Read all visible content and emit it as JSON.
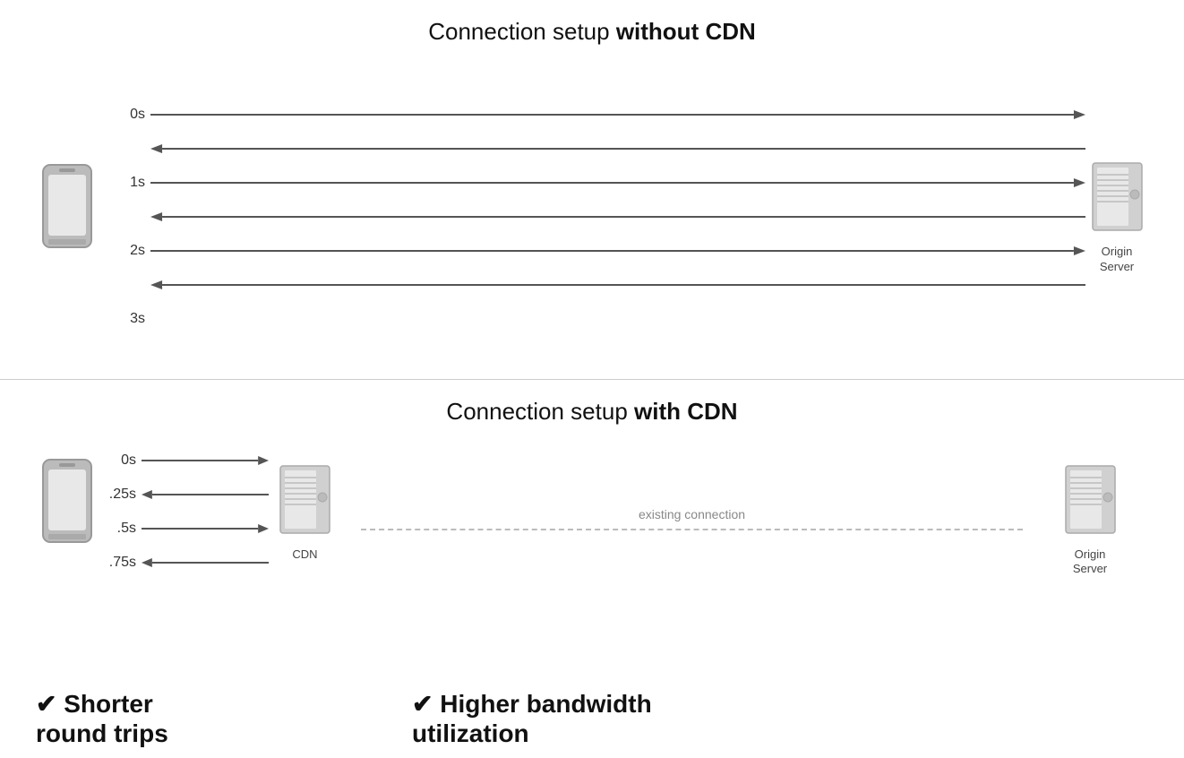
{
  "top": {
    "title_normal": "Connection setup ",
    "title_bold": "without CDN",
    "rows": [
      {
        "time": "0s",
        "direction": "right"
      },
      {
        "time": "",
        "direction": "left"
      },
      {
        "time": "1s",
        "direction": "right"
      },
      {
        "time": "",
        "direction": "left"
      },
      {
        "time": "2s",
        "direction": "right"
      },
      {
        "time": "",
        "direction": "left"
      },
      {
        "time": "3s",
        "direction": "none"
      }
    ],
    "server_label": "Origin\nServer"
  },
  "bottom": {
    "title_normal": "Connection setup ",
    "title_bold": "with CDN",
    "rows": [
      {
        "time": "0s",
        "direction": "right"
      },
      {
        "time": ".25s",
        "direction": "left"
      },
      {
        "time": ".5s",
        "direction": "right"
      },
      {
        "time": ".75s",
        "direction": "left"
      }
    ],
    "cdn_label": "CDN",
    "existing_label": "existing connection",
    "server_label": "Origin\nServer",
    "benefit_left": "✔ Shorter\nround trips",
    "benefit_right": "✔ Higher bandwidth\nutilization"
  }
}
